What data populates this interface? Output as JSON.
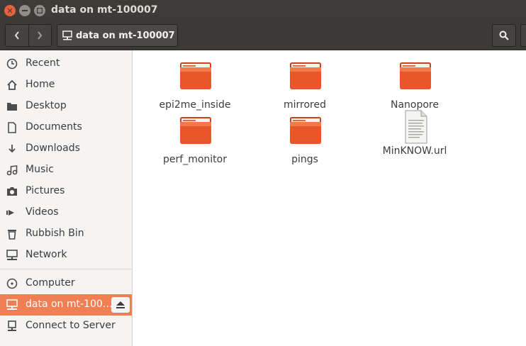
{
  "window": {
    "title": "data on mt-100007"
  },
  "header": {
    "path_label": "data on mt-100007"
  },
  "sidebar": {
    "items": [
      {
        "label": "Recent",
        "icon": "clock-icon"
      },
      {
        "label": "Home",
        "icon": "home-icon"
      },
      {
        "label": "Desktop",
        "icon": "desktop-folder-icon"
      },
      {
        "label": "Documents",
        "icon": "document-icon"
      },
      {
        "label": "Downloads",
        "icon": "download-icon"
      },
      {
        "label": "Music",
        "icon": "music-icon"
      },
      {
        "label": "Pictures",
        "icon": "camera-icon"
      },
      {
        "label": "Videos",
        "icon": "video-icon"
      },
      {
        "label": "Rubbish Bin",
        "icon": "trash-icon"
      },
      {
        "label": "Network",
        "icon": "network-icon"
      },
      {
        "label": "Computer",
        "icon": "drive-icon"
      },
      {
        "label": "data on mt-100…",
        "icon": "network-share-icon"
      },
      {
        "label": "Connect to Server",
        "icon": "server-icon"
      }
    ]
  },
  "files": [
    {
      "name": "epi2me_inside",
      "type": "folder"
    },
    {
      "name": "mirrored",
      "type": "folder"
    },
    {
      "name": "Nanopore",
      "type": "folder"
    },
    {
      "name": "perf_monitor",
      "type": "folder"
    },
    {
      "name": "pings",
      "type": "folder"
    },
    {
      "name": "MinKNOW.url",
      "type": "text-file"
    }
  ],
  "colors": {
    "accent": "#f08054",
    "titlebar": "#3c3b37",
    "folder": "#e8562a"
  }
}
